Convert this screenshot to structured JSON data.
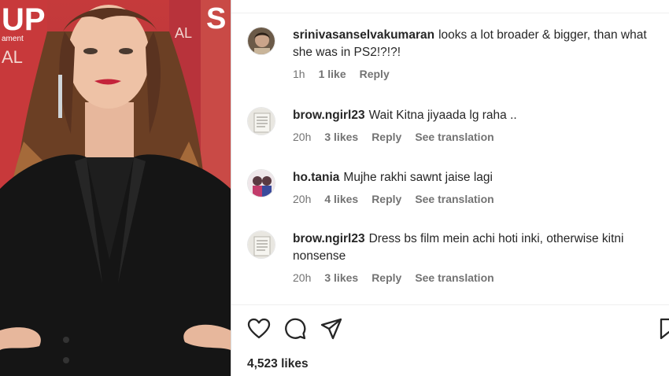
{
  "photo": {
    "banner_letters_left": "UP",
    "banner_small_left": "ament",
    "banner_brand_left": "AL",
    "banner_letter_right": "S",
    "banner_brand_right": "AL"
  },
  "comments": [
    {
      "username": "srinivasanselvakumaran",
      "text": "looks a lot broader & bigger, than what she was in PS2!?!?!",
      "time": "1h",
      "likes": "1 like",
      "reply": "Reply",
      "translation": ""
    },
    {
      "username": "brow.ngirl23",
      "text": "Wait Kitna jiyaada lg raha ..",
      "time": "20h",
      "likes": "3 likes",
      "reply": "Reply",
      "translation": "See translation"
    },
    {
      "username": "ho.tania",
      "text": "Mujhe rakhi sawnt jaise lagi",
      "time": "20h",
      "likes": "4 likes",
      "reply": "Reply",
      "translation": "See translation"
    },
    {
      "username": "brow.ngirl23",
      "text": "Dress bs film mein achi hoti inki, otherwise kitni nonsense",
      "time": "20h",
      "likes": "3 likes",
      "reply": "Reply",
      "translation": "See translation"
    }
  ],
  "actions": {
    "icons": [
      "heart-icon",
      "comment-icon",
      "share-icon",
      "bookmark-icon"
    ]
  },
  "post": {
    "likes_count": "4,523 likes"
  },
  "colors": {
    "text": "#262626",
    "meta": "#737373",
    "divider": "#dbdbdb"
  }
}
